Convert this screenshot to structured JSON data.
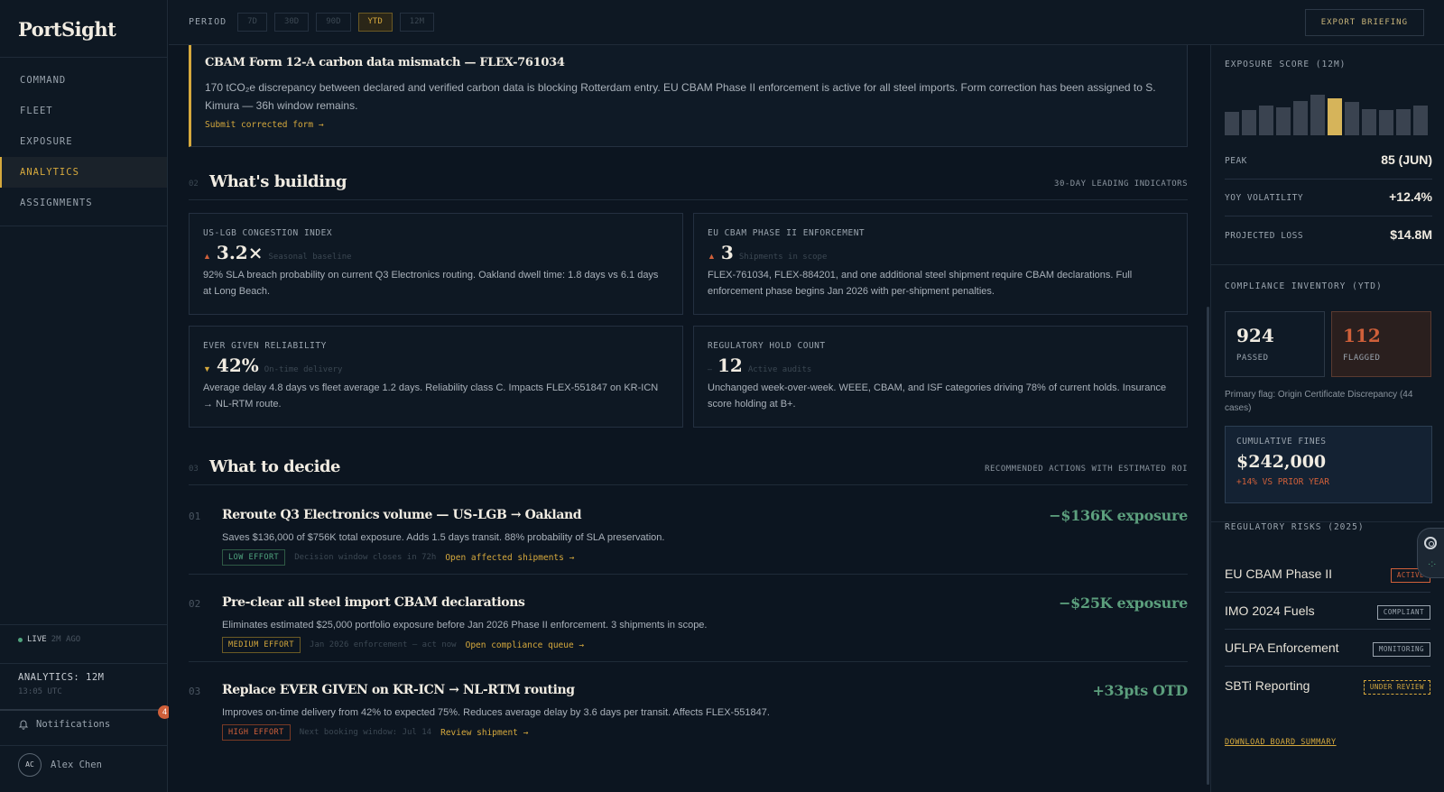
{
  "app": {
    "logo": "PortSight"
  },
  "sidebar": {
    "nav": [
      {
        "label": "COMMAND",
        "active": false
      },
      {
        "label": "FLEET",
        "active": false
      },
      {
        "label": "EXPOSURE",
        "active": false
      },
      {
        "label": "ANALYTICS",
        "active": true
      },
      {
        "label": "ASSIGNMENTS",
        "active": false
      }
    ],
    "live_label": "LIVE",
    "live_ago": "2M AGO",
    "analytics_label": "ANALYTICS: 12M",
    "analytics_time": "13:05 UTC",
    "notifications_label": "Notifications",
    "notifications_count": "4",
    "user_initials": "AC",
    "user_name": "Alex Chen"
  },
  "topbar": {
    "period_label": "PERIOD",
    "periods": [
      "7D",
      "30D",
      "90D",
      "YTD",
      "12M"
    ],
    "active_period": "YTD",
    "export_label": "EXPORT BRIEFING"
  },
  "alert": {
    "title": "CBAM Form 12-A carbon data mismatch — FLEX-761034",
    "text": "170 tCO₂e discrepancy between declared and verified carbon data is blocking Rotterdam entry. EU CBAM Phase II enforcement is active for all steel imports. Form correction has been assigned to S. Kimura — 36h window remains.",
    "link": "Submit corrected form →"
  },
  "building": {
    "num": "02",
    "title": "What's building",
    "right": "30-DAY LEADING INDICATORS",
    "cards": [
      {
        "label": "US-LGB CONGESTION INDEX",
        "trend": "up",
        "arrow": "▲",
        "value": "3.2×",
        "sub": "Seasonal baseline",
        "desc": "92% SLA breach probability on current Q3 Electronics routing. Oakland dwell time: 1.8 days vs 6.1 days at Long Beach."
      },
      {
        "label": "EU CBAM PHASE II ENFORCEMENT",
        "trend": "up",
        "arrow": "▲",
        "value": "3",
        "sub": "Shipments in scope",
        "desc": "FLEX-761034, FLEX-884201, and one additional steel shipment require CBAM declarations. Full enforcement phase begins Jan 2026 with per-shipment penalties."
      },
      {
        "label": "EVER GIVEN RELIABILITY",
        "trend": "down",
        "arrow": "▼",
        "value": "42%",
        "sub": "On-time delivery",
        "desc": "Average delay 4.8 days vs fleet average 1.2 days. Reliability class C. Impacts FLEX-551847 on KR-ICN → NL-RTM route."
      },
      {
        "label": "REGULATORY HOLD COUNT",
        "trend": "flat",
        "arrow": "–",
        "value": "12",
        "sub": "Active audits",
        "desc": "Unchanged week-over-week. WEEE, CBAM, and ISF categories driving 78% of current holds. Insurance score holding at B+."
      }
    ]
  },
  "decide": {
    "num": "03",
    "title": "What to decide",
    "right": "RECOMMENDED ACTIONS WITH ESTIMATED ROI",
    "actions": [
      {
        "num": "01",
        "title": "Reroute Q3 Electronics volume — US-LGB → Oakland",
        "desc": "Saves $136,000 of $756K total exposure. Adds 1.5 days transit. 88% probability of SLA preservation.",
        "effort": "LOW EFFORT",
        "effort_level": "low",
        "window": "Decision window closes in 72h",
        "link": "Open affected shipments →",
        "impact": "−$136K exposure"
      },
      {
        "num": "02",
        "title": "Pre-clear all steel import CBAM declarations",
        "desc": "Eliminates estimated $25,000 portfolio exposure before Jan 2026 Phase II enforcement. 3 shipments in scope.",
        "effort": "MEDIUM EFFORT",
        "effort_level": "medium",
        "window": "Jan 2026 enforcement — act now",
        "link": "Open compliance queue →",
        "impact": "−$25K exposure"
      },
      {
        "num": "03",
        "title": "Replace EVER GIVEN on KR-ICN → NL-RTM routing",
        "desc": "Improves on-time delivery from 42% to expected 75%. Reduces average delay by 3.6 days per transit. Affects FLEX-551847.",
        "effort": "HIGH EFFORT",
        "effort_level": "high",
        "window": "Next booking window: Jul 14",
        "link": "Review shipment →",
        "impact": "+33pts OTD"
      }
    ]
  },
  "right": {
    "exposure_label": "EXPOSURE SCORE (12M)",
    "exposure_bars": [
      52,
      56,
      66,
      62,
      76,
      90,
      82,
      74,
      58,
      55,
      58,
      66
    ],
    "exposure_highlight_index": 6,
    "stats": [
      {
        "label": "PEAK",
        "value": "85 (JUN)"
      },
      {
        "label": "YOY VOLATILITY",
        "value": "+12.4%"
      },
      {
        "label": "PROJECTED LOSS",
        "value": "$14.8M"
      }
    ],
    "inventory_label": "COMPLIANCE INVENTORY (YTD)",
    "passed_value": "924",
    "passed_label": "PASSED",
    "flagged_value": "112",
    "flagged_label": "FLAGGED",
    "primary_flag": "Primary flag: Origin Certificate Discrepancy (44 cases)",
    "fines_label": "CUMULATIVE FINES",
    "fines_value": "$242,000",
    "fines_delta": "+14% VS PRIOR YEAR",
    "risks_label": "REGULATORY RISKS (2025)",
    "risks": [
      {
        "name": "EU CBAM Phase II",
        "status": "ACTIVE",
        "kind": "active"
      },
      {
        "name": "IMO 2024 Fuels",
        "status": "COMPLIANT",
        "kind": "compliant"
      },
      {
        "name": "UFLPA Enforcement",
        "status": "MONITORING",
        "kind": "monitoring"
      },
      {
        "name": "SBTi Reporting",
        "status": "UNDER REVIEW",
        "kind": "review"
      }
    ],
    "download_label": "DOWNLOAD BOARD SUMMARY"
  }
}
